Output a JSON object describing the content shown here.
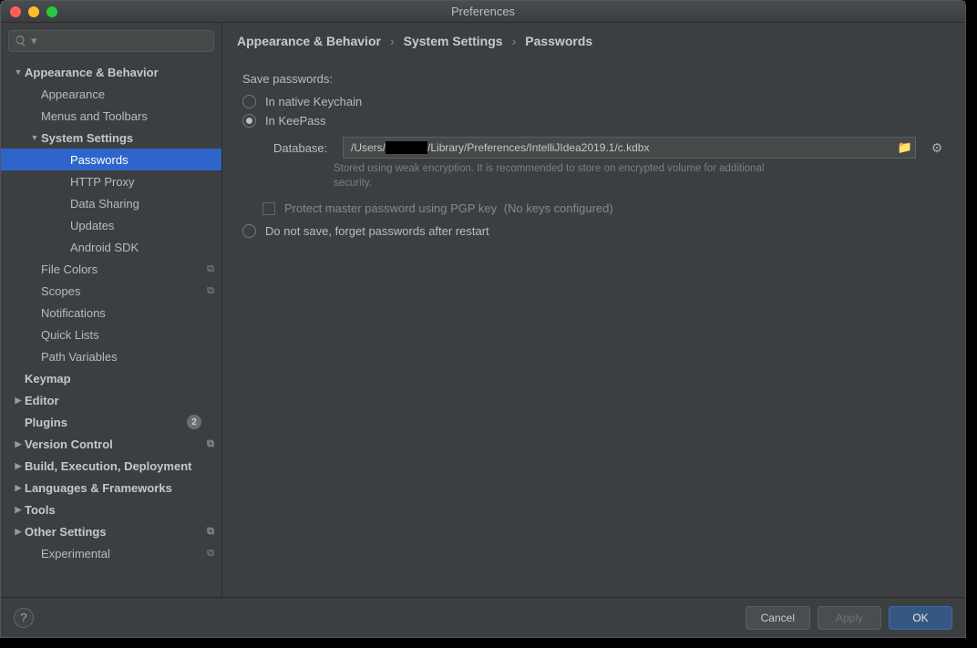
{
  "window": {
    "title": "Preferences"
  },
  "search": {
    "placeholder": ""
  },
  "sidebar": {
    "items": [
      {
        "label": "Appearance & Behavior",
        "bold": true,
        "arrow": "▼",
        "indent": 0
      },
      {
        "label": "Appearance",
        "indent": 1
      },
      {
        "label": "Menus and Toolbars",
        "indent": 1
      },
      {
        "label": "System Settings",
        "bold": true,
        "arrow": "▼",
        "indent": 1
      },
      {
        "label": "Passwords",
        "indent": 3,
        "selected": true
      },
      {
        "label": "HTTP Proxy",
        "indent": 3
      },
      {
        "label": "Data Sharing",
        "indent": 3
      },
      {
        "label": "Updates",
        "indent": 3
      },
      {
        "label": "Android SDK",
        "indent": 3
      },
      {
        "label": "File Colors",
        "indent": 1,
        "copy": true
      },
      {
        "label": "Scopes",
        "indent": 1,
        "copy": true
      },
      {
        "label": "Notifications",
        "indent": 1
      },
      {
        "label": "Quick Lists",
        "indent": 1
      },
      {
        "label": "Path Variables",
        "indent": 1
      },
      {
        "label": "Keymap",
        "bold": true,
        "indent": 0
      },
      {
        "label": "Editor",
        "bold": true,
        "arrow": "▶",
        "indent": 0
      },
      {
        "label": "Plugins",
        "bold": true,
        "indent": 0,
        "badge": "2"
      },
      {
        "label": "Version Control",
        "bold": true,
        "arrow": "▶",
        "indent": 0,
        "copy": true
      },
      {
        "label": "Build, Execution, Deployment",
        "bold": true,
        "arrow": "▶",
        "indent": 0
      },
      {
        "label": "Languages & Frameworks",
        "bold": true,
        "arrow": "▶",
        "indent": 0
      },
      {
        "label": "Tools",
        "bold": true,
        "arrow": "▶",
        "indent": 0
      },
      {
        "label": "Other Settings",
        "bold": true,
        "arrow": "▶",
        "indent": 0,
        "copy": true
      },
      {
        "label": "Experimental",
        "indent": 1,
        "copy": true
      }
    ]
  },
  "breadcrumb": {
    "a": "Appearance & Behavior",
    "b": "System Settings",
    "c": "Passwords",
    "sep": "›"
  },
  "panel": {
    "save_label": "Save passwords:",
    "opt_native": "In native Keychain",
    "opt_keepass": "In KeePass",
    "db_label": "Database:",
    "db_prefix": "/Users/",
    "db_suffix": "/Library/Preferences/IntelliJIdea2019.1/c.kdbx",
    "db_hint": "Stored using weak encryption. It is recommended to store on encrypted volume for additional security.",
    "protect_label": "Protect master password using PGP key",
    "protect_note": "(No keys configured)",
    "opt_forget": "Do not save, forget passwords after restart"
  },
  "footer": {
    "cancel": "Cancel",
    "apply": "Apply",
    "ok": "OK",
    "help": "?"
  }
}
